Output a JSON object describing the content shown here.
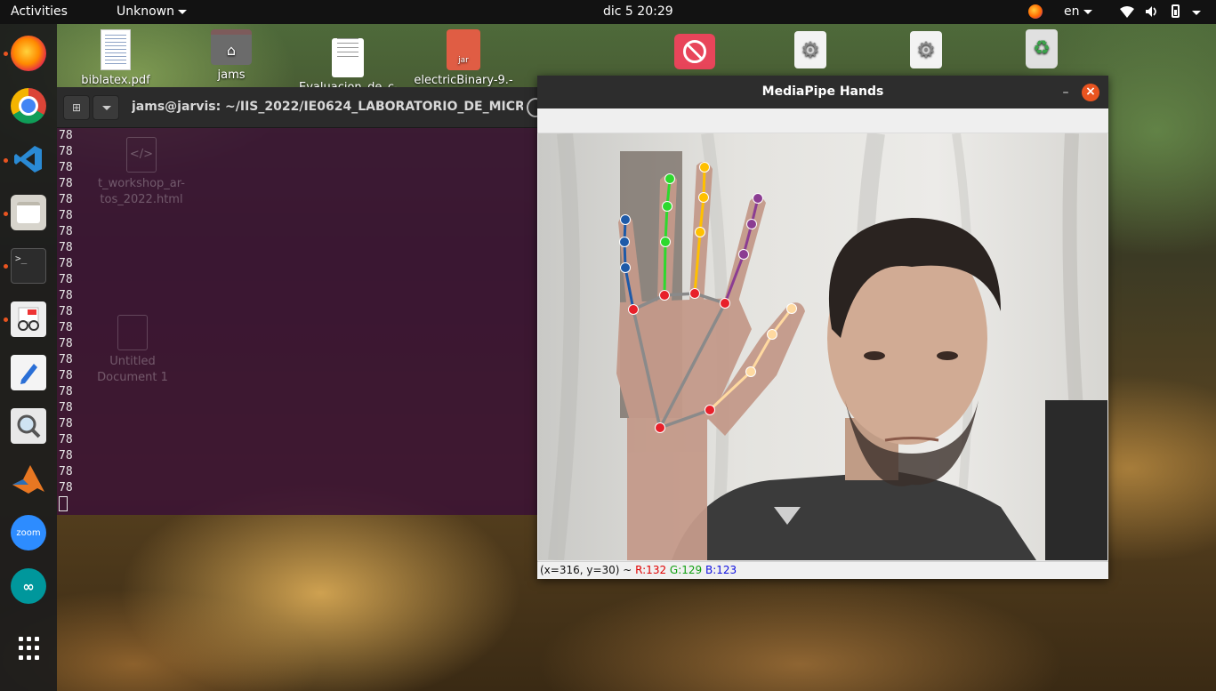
{
  "topbar": {
    "activities": "Activities",
    "app_menu": "Unknown",
    "clock": "dic 5  20:29",
    "language": "en"
  },
  "dock": {
    "items": [
      "firefox-icon",
      "chrome-icon",
      "vscode-icon",
      "files-icon",
      "terminal-icon",
      "document-viewer-icon",
      "text-editor-icon",
      "search-icon",
      "matlab-icon",
      "zoom-icon",
      "arduino-icon",
      "app-grid-icon"
    ],
    "zoom_label": "zoom",
    "terminal_glyph": ">_"
  },
  "desktop_icons": {
    "biblatex": "biblatex.pdf",
    "home": "jams",
    "evaluacion": "Evaluacion_de_c-",
    "electric": "electricBinary-9.-",
    "jar_tag": "jar",
    "workshop": "t_workshop_ar-\ntos_2022.html",
    "untitled": "Untitled\nDocument 1"
  },
  "terminal": {
    "title": "jams@jarvis: ~/IIS_2022/IE0624_LABORATORIO_DE_MICR...",
    "lines": [
      "78",
      "78",
      "78",
      "78",
      "78",
      "78",
      "78",
      "78",
      "78",
      "78",
      "78",
      "78",
      "78",
      "78",
      "78",
      "78",
      "78",
      "78",
      "78",
      "78",
      "78",
      "78",
      "78"
    ]
  },
  "mediapipe": {
    "title": "MediaPipe Hands",
    "status_prefix": "(x=316, y=30) ~ ",
    "status_r": "R:132",
    "status_g": "G:129",
    "status_b": "B:123"
  },
  "colors": {
    "accent": "#e95420",
    "terminal_bg": "#3a1234",
    "landmark_red": "#e8202a",
    "thumb": "#ffd9a0",
    "index": "#8b3d92",
    "middle": "#ffc000",
    "ring": "#2ed92e",
    "pinky": "#1e5aa8"
  }
}
